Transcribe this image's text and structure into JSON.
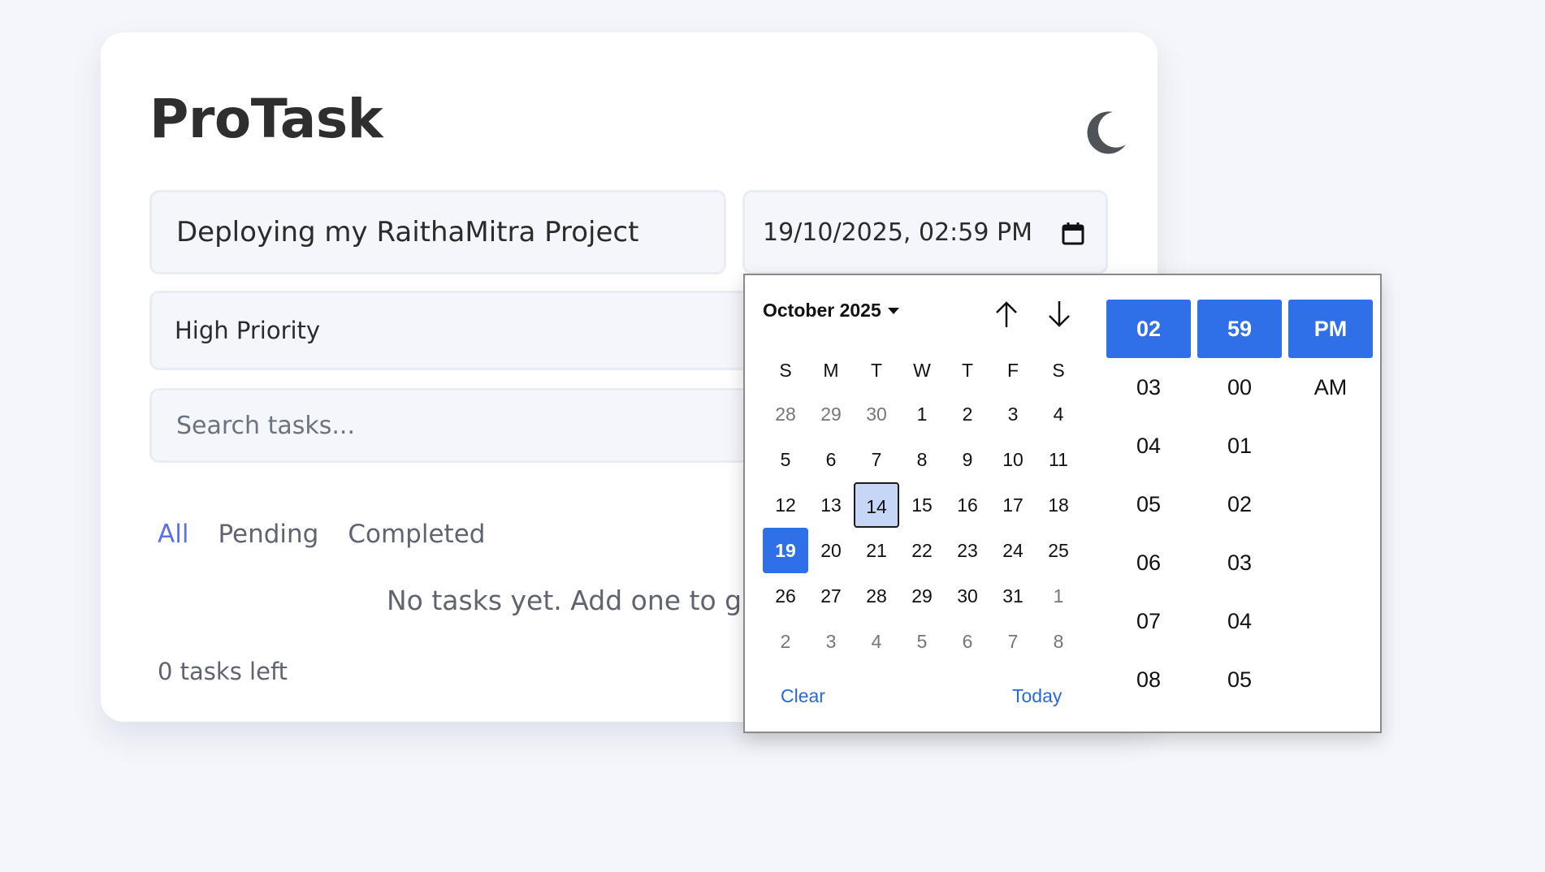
{
  "app": {
    "title": "ProTask"
  },
  "form": {
    "task_value": "Deploying my RaithaMitra Project",
    "datetime_value": "19/10/2025, 02:59 PM",
    "priority_value": "High Priority",
    "search_placeholder": "Search tasks..."
  },
  "filters": [
    {
      "label": "All",
      "active": true
    },
    {
      "label": "Pending",
      "active": false
    },
    {
      "label": "Completed",
      "active": false
    }
  ],
  "empty_message": "No tasks yet. Add one to get",
  "tasks_left": "0 tasks left",
  "picker": {
    "month_label": "October 2025",
    "weekdays": [
      "S",
      "M",
      "T",
      "W",
      "T",
      "F",
      "S"
    ],
    "weeks": [
      [
        "28",
        "29",
        "30",
        "1",
        "2",
        "3",
        "4"
      ],
      [
        "5",
        "6",
        "7",
        "8",
        "9",
        "10",
        "11"
      ],
      [
        "12",
        "13",
        "14",
        "15",
        "16",
        "17",
        "18"
      ],
      [
        "19",
        "20",
        "21",
        "22",
        "23",
        "24",
        "25"
      ],
      [
        "26",
        "27",
        "28",
        "29",
        "30",
        "31",
        "1"
      ],
      [
        "2",
        "3",
        "4",
        "5",
        "6",
        "7",
        "8"
      ]
    ],
    "clear_label": "Clear",
    "today_label": "Today",
    "hours": [
      "02",
      "03",
      "04",
      "05",
      "06",
      "07",
      "08"
    ],
    "minutes": [
      "59",
      "00",
      "01",
      "02",
      "03",
      "04",
      "05"
    ],
    "periods": [
      "PM",
      "AM"
    ]
  },
  "colors": {
    "accent": "#2f6fe8",
    "filter_active": "#5b72e0",
    "today_bg": "#c6d6f7"
  },
  "icons": {
    "theme_toggle": "moon-icon",
    "calendar": "calendar-icon",
    "prev_month": "arrow-up-icon",
    "next_month": "arrow-down-icon"
  }
}
